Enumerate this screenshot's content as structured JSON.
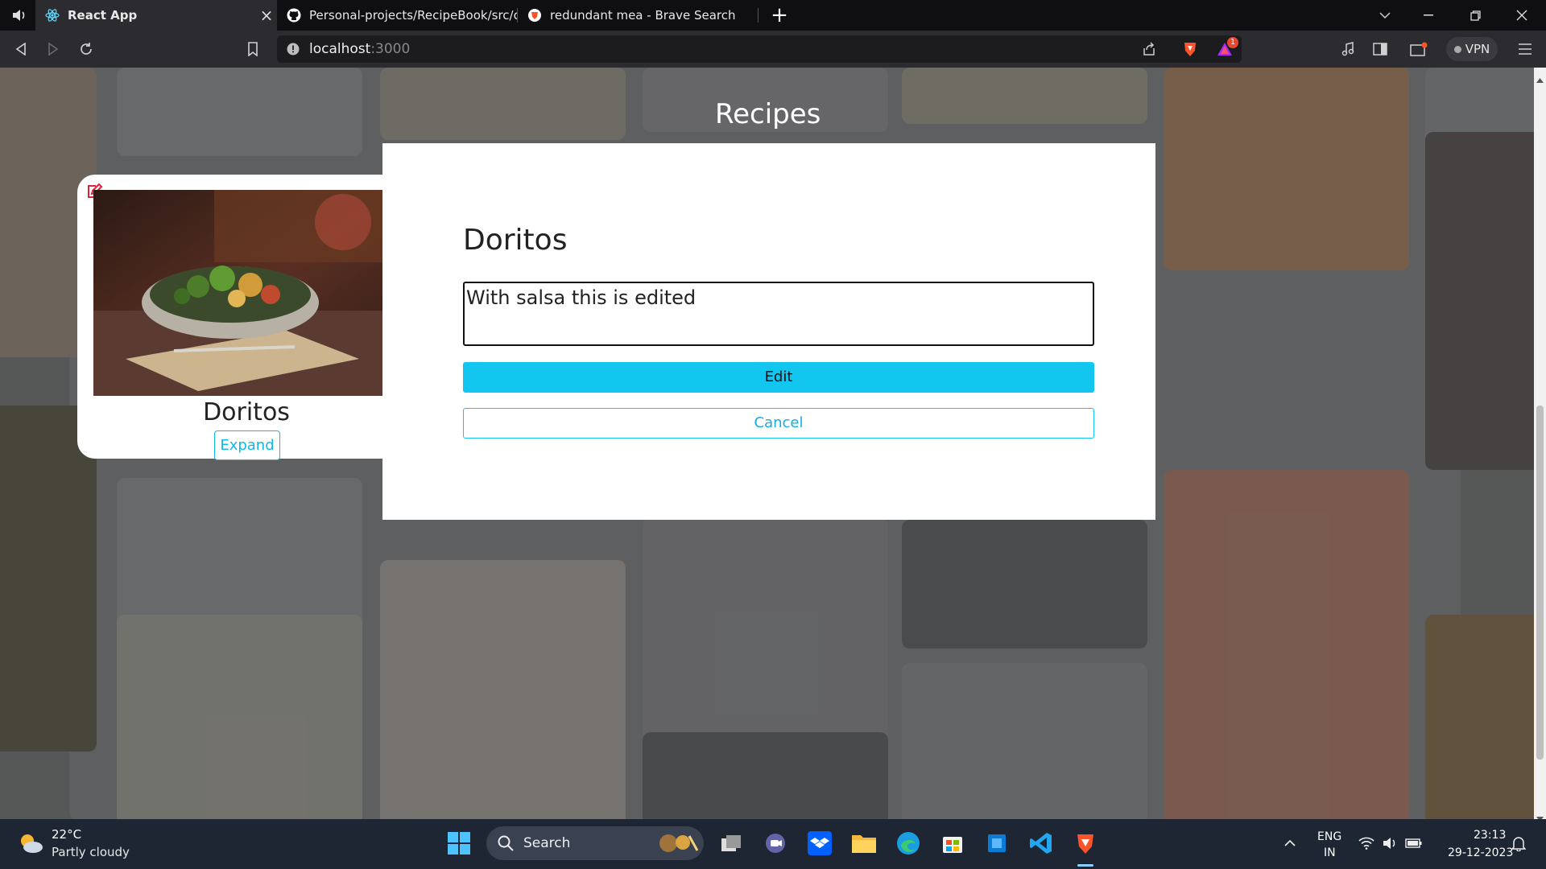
{
  "browser": {
    "tabs": [
      {
        "title": "React App",
        "active": true
      },
      {
        "title": "Personal-projects/RecipeBook/src/com",
        "active": false
      },
      {
        "title": "redundant mea - Brave Search",
        "active": false
      }
    ],
    "new_tab": "+",
    "url_host": "localhost",
    "url_port": ":3000",
    "vpn_label": "VPN",
    "notification_count": "1"
  },
  "page": {
    "title": "Recipes",
    "card": {
      "title": "Doritos",
      "expand_label": "Expand"
    },
    "modal": {
      "title": "Doritos",
      "text_value": "With salsa this is edited",
      "edit_label": "Edit",
      "cancel_label": "Cancel"
    }
  },
  "taskbar": {
    "weather_temp": "22°C",
    "weather_desc": "Partly cloudy",
    "search_label": "Search",
    "lang_line1": "ENG",
    "lang_line2": "IN",
    "time": "23:13",
    "date": "29-12-2023"
  },
  "colors": {
    "accent": "#12c6ef",
    "edit_icon": "#e0203a"
  }
}
